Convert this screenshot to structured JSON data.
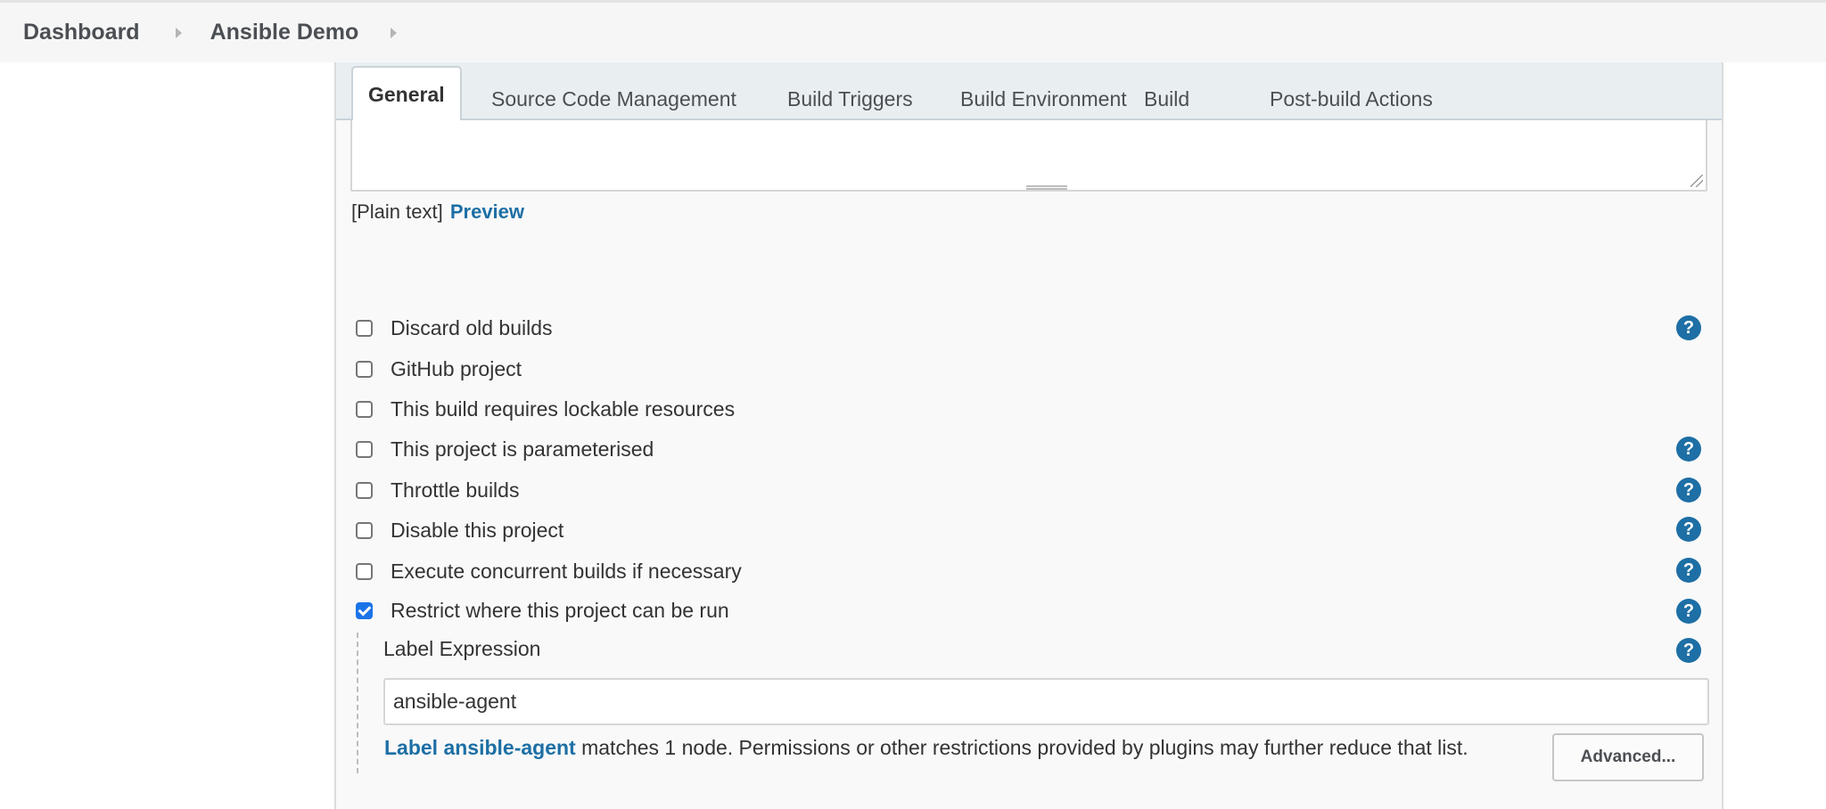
{
  "breadcrumb": {
    "items": [
      "Dashboard",
      "Ansible Demo"
    ]
  },
  "tabs": [
    {
      "label": "General",
      "active": true
    },
    {
      "label": "Source Code Management",
      "active": false
    },
    {
      "label": "Build Triggers",
      "active": false
    },
    {
      "label": "Build Environment",
      "active": false
    },
    {
      "label": "Build",
      "active": false
    },
    {
      "label": "Post-build Actions",
      "active": false
    }
  ],
  "description": {
    "format_text": "[Plain text]",
    "preview_link": "Preview"
  },
  "options": [
    {
      "label": "Discard old builds",
      "checked": false,
      "help": true
    },
    {
      "label": "GitHub project",
      "checked": false,
      "help": false
    },
    {
      "label": "This build requires lockable resources",
      "checked": false,
      "help": false
    },
    {
      "label": "This project is parameterised",
      "checked": false,
      "help": true
    },
    {
      "label": "Throttle builds",
      "checked": false,
      "help": true
    },
    {
      "label": "Disable this project",
      "checked": false,
      "help": true
    },
    {
      "label": "Execute concurrent builds if necessary",
      "checked": false,
      "help": true
    },
    {
      "label": "Restrict where this project can be run",
      "checked": true,
      "help": true
    }
  ],
  "restrict": {
    "field_label": "Label Expression",
    "field_value": "ansible-agent",
    "match_link": "Label ansible-agent",
    "match_text": " matches 1 node. Permissions or other restrictions provided by plugins may further reduce that list."
  },
  "advanced_button": "Advanced...",
  "help_glyph": "?",
  "colors": {
    "link": "#1d6fa5",
    "help_icon": "#1d6fa5",
    "checkbox_checked": "#1a73e8"
  }
}
